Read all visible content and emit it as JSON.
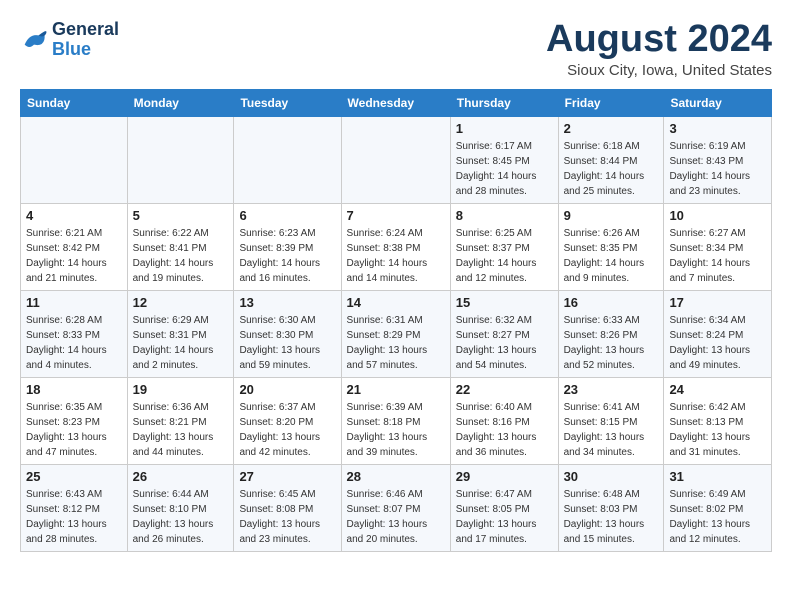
{
  "logo": {
    "line1": "General",
    "line2": "Blue"
  },
  "title": "August 2024",
  "subtitle": "Sioux City, Iowa, United States",
  "headers": [
    "Sunday",
    "Monday",
    "Tuesday",
    "Wednesday",
    "Thursday",
    "Friday",
    "Saturday"
  ],
  "weeks": [
    [
      {
        "day": "",
        "detail": ""
      },
      {
        "day": "",
        "detail": ""
      },
      {
        "day": "",
        "detail": ""
      },
      {
        "day": "",
        "detail": ""
      },
      {
        "day": "1",
        "detail": "Sunrise: 6:17 AM\nSunset: 8:45 PM\nDaylight: 14 hours\nand 28 minutes."
      },
      {
        "day": "2",
        "detail": "Sunrise: 6:18 AM\nSunset: 8:44 PM\nDaylight: 14 hours\nand 25 minutes."
      },
      {
        "day": "3",
        "detail": "Sunrise: 6:19 AM\nSunset: 8:43 PM\nDaylight: 14 hours\nand 23 minutes."
      }
    ],
    [
      {
        "day": "4",
        "detail": "Sunrise: 6:21 AM\nSunset: 8:42 PM\nDaylight: 14 hours\nand 21 minutes."
      },
      {
        "day": "5",
        "detail": "Sunrise: 6:22 AM\nSunset: 8:41 PM\nDaylight: 14 hours\nand 19 minutes."
      },
      {
        "day": "6",
        "detail": "Sunrise: 6:23 AM\nSunset: 8:39 PM\nDaylight: 14 hours\nand 16 minutes."
      },
      {
        "day": "7",
        "detail": "Sunrise: 6:24 AM\nSunset: 8:38 PM\nDaylight: 14 hours\nand 14 minutes."
      },
      {
        "day": "8",
        "detail": "Sunrise: 6:25 AM\nSunset: 8:37 PM\nDaylight: 14 hours\nand 12 minutes."
      },
      {
        "day": "9",
        "detail": "Sunrise: 6:26 AM\nSunset: 8:35 PM\nDaylight: 14 hours\nand 9 minutes."
      },
      {
        "day": "10",
        "detail": "Sunrise: 6:27 AM\nSunset: 8:34 PM\nDaylight: 14 hours\nand 7 minutes."
      }
    ],
    [
      {
        "day": "11",
        "detail": "Sunrise: 6:28 AM\nSunset: 8:33 PM\nDaylight: 14 hours\nand 4 minutes."
      },
      {
        "day": "12",
        "detail": "Sunrise: 6:29 AM\nSunset: 8:31 PM\nDaylight: 14 hours\nand 2 minutes."
      },
      {
        "day": "13",
        "detail": "Sunrise: 6:30 AM\nSunset: 8:30 PM\nDaylight: 13 hours\nand 59 minutes."
      },
      {
        "day": "14",
        "detail": "Sunrise: 6:31 AM\nSunset: 8:29 PM\nDaylight: 13 hours\nand 57 minutes."
      },
      {
        "day": "15",
        "detail": "Sunrise: 6:32 AM\nSunset: 8:27 PM\nDaylight: 13 hours\nand 54 minutes."
      },
      {
        "day": "16",
        "detail": "Sunrise: 6:33 AM\nSunset: 8:26 PM\nDaylight: 13 hours\nand 52 minutes."
      },
      {
        "day": "17",
        "detail": "Sunrise: 6:34 AM\nSunset: 8:24 PM\nDaylight: 13 hours\nand 49 minutes."
      }
    ],
    [
      {
        "day": "18",
        "detail": "Sunrise: 6:35 AM\nSunset: 8:23 PM\nDaylight: 13 hours\nand 47 minutes."
      },
      {
        "day": "19",
        "detail": "Sunrise: 6:36 AM\nSunset: 8:21 PM\nDaylight: 13 hours\nand 44 minutes."
      },
      {
        "day": "20",
        "detail": "Sunrise: 6:37 AM\nSunset: 8:20 PM\nDaylight: 13 hours\nand 42 minutes."
      },
      {
        "day": "21",
        "detail": "Sunrise: 6:39 AM\nSunset: 8:18 PM\nDaylight: 13 hours\nand 39 minutes."
      },
      {
        "day": "22",
        "detail": "Sunrise: 6:40 AM\nSunset: 8:16 PM\nDaylight: 13 hours\nand 36 minutes."
      },
      {
        "day": "23",
        "detail": "Sunrise: 6:41 AM\nSunset: 8:15 PM\nDaylight: 13 hours\nand 34 minutes."
      },
      {
        "day": "24",
        "detail": "Sunrise: 6:42 AM\nSunset: 8:13 PM\nDaylight: 13 hours\nand 31 minutes."
      }
    ],
    [
      {
        "day": "25",
        "detail": "Sunrise: 6:43 AM\nSunset: 8:12 PM\nDaylight: 13 hours\nand 28 minutes."
      },
      {
        "day": "26",
        "detail": "Sunrise: 6:44 AM\nSunset: 8:10 PM\nDaylight: 13 hours\nand 26 minutes."
      },
      {
        "day": "27",
        "detail": "Sunrise: 6:45 AM\nSunset: 8:08 PM\nDaylight: 13 hours\nand 23 minutes."
      },
      {
        "day": "28",
        "detail": "Sunrise: 6:46 AM\nSunset: 8:07 PM\nDaylight: 13 hours\nand 20 minutes."
      },
      {
        "day": "29",
        "detail": "Sunrise: 6:47 AM\nSunset: 8:05 PM\nDaylight: 13 hours\nand 17 minutes."
      },
      {
        "day": "30",
        "detail": "Sunrise: 6:48 AM\nSunset: 8:03 PM\nDaylight: 13 hours\nand 15 minutes."
      },
      {
        "day": "31",
        "detail": "Sunrise: 6:49 AM\nSunset: 8:02 PM\nDaylight: 13 hours\nand 12 minutes."
      }
    ]
  ]
}
